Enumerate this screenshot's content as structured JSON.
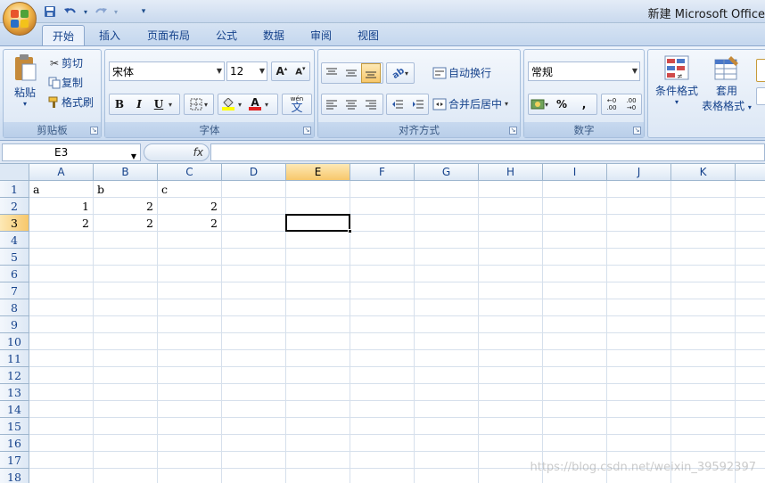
{
  "window": {
    "title": "新建 Microsoft Office"
  },
  "quick_access": {
    "icons": [
      "save-icon",
      "undo-icon",
      "redo-icon",
      "customize-icon"
    ]
  },
  "tabs": [
    {
      "label": "开始",
      "active": true
    },
    {
      "label": "插入"
    },
    {
      "label": "页面布局"
    },
    {
      "label": "公式"
    },
    {
      "label": "数据"
    },
    {
      "label": "审阅"
    },
    {
      "label": "视图"
    }
  ],
  "ribbon": {
    "clipboard": {
      "label": "剪贴板",
      "paste": "粘贴",
      "cut": "剪切",
      "copy": "复制",
      "format_painter": "格式刷"
    },
    "font": {
      "label": "字体",
      "font_name": "宋体",
      "font_size": "12",
      "font_color": "#e02020",
      "fill_color": "#ffff00",
      "phonetic": "wén"
    },
    "alignment": {
      "label": "对齐方式",
      "wrap_text": "自动换行",
      "merge_center": "合并后居中"
    },
    "number": {
      "label": "数字",
      "format": "常规"
    },
    "styles": {
      "conditional": "条件格式",
      "table_format_line1": "套用",
      "table_format_line2": "表格格式"
    }
  },
  "formula_bar": {
    "name_box": "E3",
    "fx": "fx",
    "content": ""
  },
  "sheet": {
    "columns": [
      "A",
      "B",
      "C",
      "D",
      "E",
      "F",
      "G",
      "H",
      "I",
      "J",
      "K"
    ],
    "rows": [
      "1",
      "2",
      "3",
      "4",
      "5",
      "6",
      "7",
      "8",
      "9",
      "10",
      "11",
      "12",
      "13",
      "14",
      "15",
      "16",
      "17",
      "18"
    ],
    "selected_cell": "E3",
    "cells": {
      "A1": "a",
      "B1": "b",
      "C1": "c",
      "A2": "1",
      "B2": "2",
      "C2": "2",
      "A3": "2",
      "B3": "2",
      "C3": "2"
    }
  },
  "watermark": "https://blog.csdn.net/weixin_39592397"
}
